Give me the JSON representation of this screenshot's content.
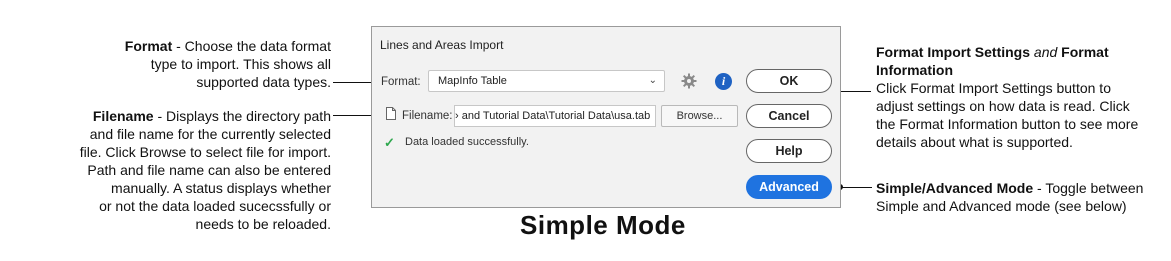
{
  "annotations": {
    "format": {
      "title": "Format",
      "lines": [
        "- Choose the data format",
        "type to import. This shows all",
        "supported data types."
      ]
    },
    "filename": {
      "title": "Filename",
      "lines": [
        "- Displays the directory path",
        "and file name for the currently selected",
        "file. Click Browse to select file for import.",
        "Path and file name can also be entered",
        "manually. A status displays whether",
        "or not the data loaded sucecssfully or",
        "needs to be reloaded."
      ]
    },
    "settings": {
      "title1": "Format Import Settings",
      "and": "and",
      "title2": "Format Information",
      "lines": [
        "Click Format Import Settings button to",
        "adjust settings on how data is read. Click",
        "the Format Information button to see more",
        "details about what is supported."
      ]
    },
    "mode": {
      "title": "Simple/Advanced Mode",
      "lines": [
        "- Toggle between",
        "Simple and Advanced mode (see below)"
      ]
    }
  },
  "caption": "Simple Mode",
  "dialog": {
    "title": "Lines and Areas Import",
    "format_label": "Format:",
    "format_value": "MapInfo Table",
    "filename_label": "Filename:",
    "filename_value": "› and Tutorial Data\\Tutorial Data\\usa.tab",
    "browse_label": "Browse...",
    "status_text": "Data loaded successfully.",
    "ok_label": "OK",
    "cancel_label": "Cancel",
    "help_label": "Help",
    "advanced_label": "Advanced",
    "icons": [
      "gear-icon",
      "info-icon",
      "file-icon",
      "check-icon",
      "chevron-down-icon"
    ]
  },
  "colors": {
    "accent": "#1f73e0",
    "info": "#1f62c3",
    "success": "#2fa84f"
  }
}
